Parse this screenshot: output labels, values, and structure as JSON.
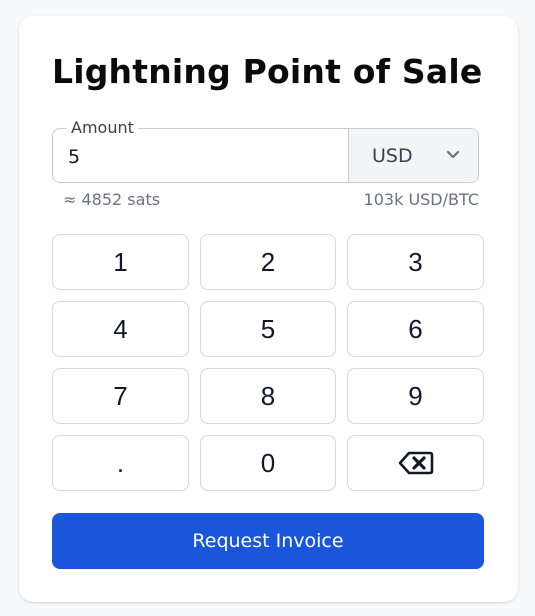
{
  "title": "Lightning Point of Sale",
  "amount": {
    "legend": "Amount",
    "value": "5",
    "currency": "USD"
  },
  "conversion": {
    "sats": "≈ 4852 sats",
    "rate": "103k USD/BTC"
  },
  "keypad": {
    "keys": [
      "1",
      "2",
      "3",
      "4",
      "5",
      "6",
      "7",
      "8",
      "9",
      ".",
      "0"
    ],
    "backspace_icon": "backspace-icon"
  },
  "actions": {
    "request_label": "Request Invoice"
  },
  "colors": {
    "primary": "#1a56db",
    "card": "#ffffff",
    "background": "#f8f9fb"
  }
}
